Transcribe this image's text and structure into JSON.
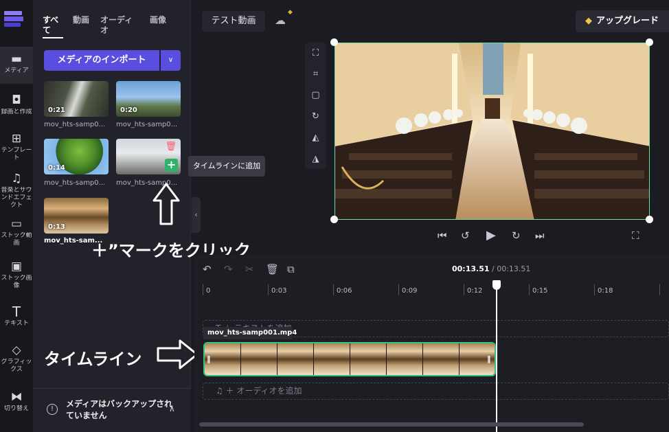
{
  "rail": {
    "items": [
      {
        "icon": "folder-icon",
        "label": "メディア"
      },
      {
        "icon": "camera-icon",
        "label": "録画と作成"
      },
      {
        "icon": "template-icon",
        "label": "テンプレート"
      },
      {
        "icon": "music-icon",
        "label": "音楽とサウンドエフェクト"
      },
      {
        "icon": "stock-video-icon",
        "label": "ストック動画"
      },
      {
        "icon": "stock-image-icon",
        "label": "ストック画像"
      },
      {
        "icon": "text-icon",
        "label": "テキスト"
      },
      {
        "icon": "graphics-icon",
        "label": "グラフィックス"
      },
      {
        "icon": "transition-icon",
        "label": "切り替え"
      }
    ]
  },
  "media": {
    "tabs": [
      "すべて",
      "動画",
      "オーディオ",
      "画像"
    ],
    "import_label": "メディアのインポート",
    "items": [
      {
        "duration": "0:21",
        "name": "mov_hts-samp0..."
      },
      {
        "duration": "0:20",
        "name": "mov_hts-samp0..."
      },
      {
        "duration": "0:14",
        "name": "mov_hts-samp0..."
      },
      {
        "duration": "",
        "name": "mov_hts-samp0..."
      },
      {
        "duration": "0:13",
        "name": "mov_hts-sam..."
      }
    ],
    "tooltip": "タイムラインに追加",
    "backup": "メディアはバックアップされていません"
  },
  "annotations": {
    "click_plus": "＋”マークをクリック",
    "timeline": "タイムライン"
  },
  "header": {
    "project_title": "テスト動画",
    "upgrade_label": "アップグレード"
  },
  "timeline": {
    "current_time": "00:13.51",
    "total_time": "/ 00:13.51",
    "ticks": [
      "0",
      "0:03",
      "0:06",
      "0:09",
      "0:12",
      "0:15",
      "0:18"
    ],
    "text_track": "T  ＋ テキストを追加",
    "audio_track": "♫  ＋ オーディオを追加",
    "clip_name": "mov_hts-samp001.mp4"
  },
  "colors": {
    "accent": "#5a4ee0",
    "selection": "#6fe0a2",
    "add": "#2fb36b"
  }
}
